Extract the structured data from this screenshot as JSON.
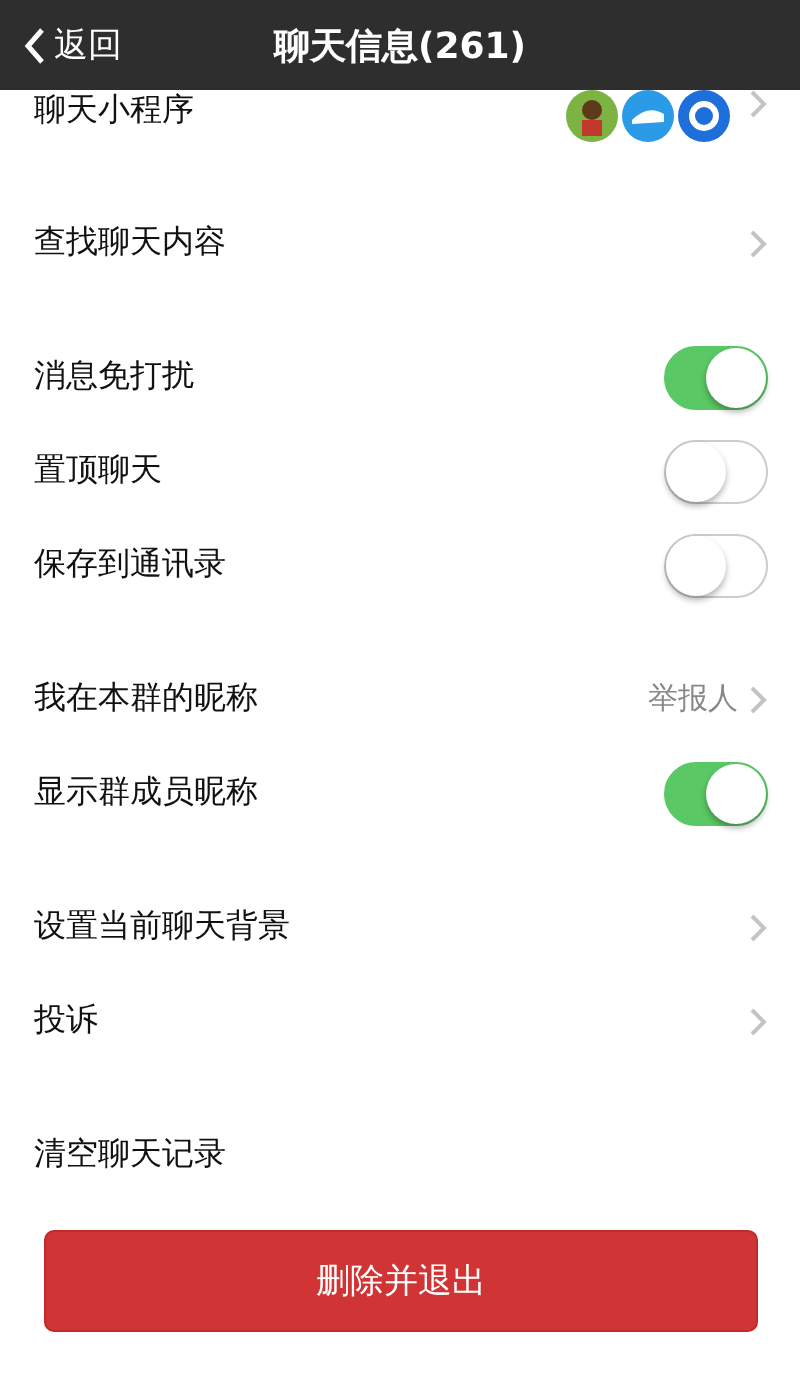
{
  "header": {
    "back": "返回",
    "title": "聊天信息(261)"
  },
  "sections": [
    [
      {
        "kind": "apps",
        "label": "聊天小程序"
      }
    ],
    [
      {
        "kind": "link",
        "label": "查找聊天内容"
      }
    ],
    [
      {
        "kind": "toggle",
        "label": "消息免打扰",
        "on": true
      },
      {
        "kind": "toggle",
        "label": "置顶聊天",
        "on": false
      },
      {
        "kind": "toggle",
        "label": "保存到通讯录",
        "on": false
      }
    ],
    [
      {
        "kind": "link",
        "label": "我在本群的昵称",
        "value": "举报人"
      },
      {
        "kind": "toggle",
        "label": "显示群成员昵称",
        "on": true
      }
    ],
    [
      {
        "kind": "link",
        "label": "设置当前聊天背景"
      },
      {
        "kind": "link",
        "label": "投诉"
      }
    ],
    [
      {
        "kind": "plain",
        "label": "清空聊天记录"
      }
    ]
  ],
  "exit_button": "删除并退出"
}
